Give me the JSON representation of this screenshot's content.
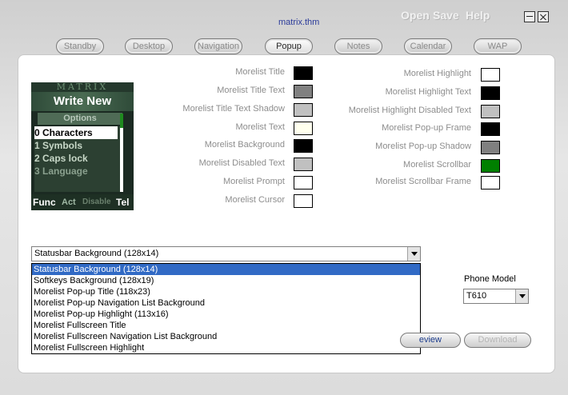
{
  "window": {
    "title": "matrix.thm"
  },
  "menu": {
    "open": "Open",
    "save": "Save",
    "help": "Help"
  },
  "tabs": [
    "Standby",
    "Desktop",
    "Navigation",
    "Popup",
    "Notes",
    "Calendar",
    "WAP"
  ],
  "active_tab": "Popup",
  "phone_preview": {
    "header": "MATRIX",
    "title": "Write New",
    "options": "Options",
    "items": [
      "0 Characters",
      "1 Symbols",
      "2 Caps lock",
      "3 Language"
    ],
    "softkeys": {
      "left": "Func",
      "middle": "Act",
      "disabled": "Disable",
      "right": "Tel"
    }
  },
  "colors_left": [
    {
      "label": "Morelist Title",
      "color": "#000000"
    },
    {
      "label": "Morelist Title Text",
      "color": "#808080"
    },
    {
      "label": "Morelist Title Text Shadow",
      "color": "#c0c0c0"
    },
    {
      "label": "Morelist Text",
      "color": "#ffffee"
    },
    {
      "label": "Morelist Background",
      "color": "#000000"
    },
    {
      "label": "Morelist Disabled Text",
      "color": "#c0c0c0"
    },
    {
      "label": "Morelist Prompt",
      "color": "#ffffff"
    },
    {
      "label": "Morelist Cursor",
      "color": "#ffffff"
    }
  ],
  "colors_right": [
    {
      "label": "Morelist Highlight",
      "color": "#ffffff"
    },
    {
      "label": "Morelist Highlight Text",
      "color": "#000000"
    },
    {
      "label": "Morelist Highlight Disabled Text",
      "color": "#c0c0c0"
    },
    {
      "label": "Morelist Pop-up Frame",
      "color": "#000000"
    },
    {
      "label": "Morelist Pop-up Shadow",
      "color": "#808080"
    },
    {
      "label": "Morelist Scrollbar",
      "color": "#008000"
    },
    {
      "label": "Morelist Scrollbar Frame",
      "color": "#ffffff"
    }
  ],
  "image_select": {
    "value": "Statusbar Background (128x14)",
    "options": [
      "Statusbar Background (128x14)",
      "Softkeys Background (128x19)",
      "Morelist Pop-up Title (118x23)",
      "Morelist Pop-up Navigation List Background",
      "Morelist Pop-up Highlight (113x16)",
      "Morelist Fullscreen Title",
      "Morelist Fullscreen Navigation List Background",
      "Morelist Fullscreen Highlight"
    ]
  },
  "phone_model": {
    "label": "Phone Model",
    "value": "T610"
  },
  "buttons": {
    "preview": "Preview",
    "preview_visible": "eview",
    "download": "Download"
  }
}
